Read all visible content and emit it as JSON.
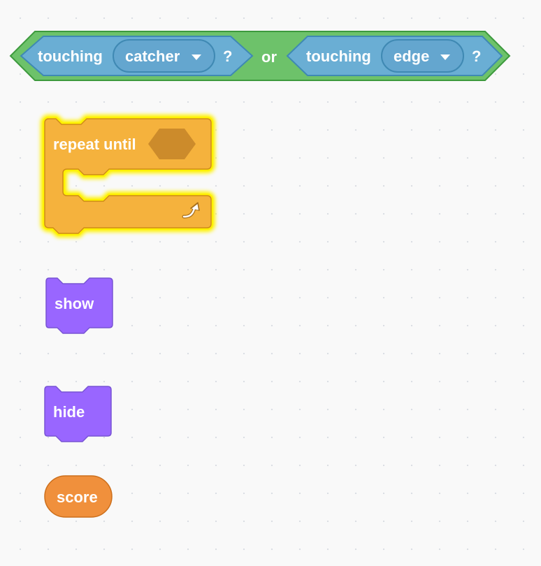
{
  "blocks": {
    "or_condition": {
      "left": {
        "label": "touching",
        "menu_value": "catcher",
        "suffix": "?"
      },
      "operator": "or",
      "right": {
        "label": "touching",
        "menu_value": "edge",
        "suffix": "?"
      }
    },
    "repeat_until": {
      "label": "repeat until"
    },
    "show": {
      "label": "show"
    },
    "hide": {
      "label": "hide"
    },
    "score": {
      "label": "score"
    }
  },
  "colors": {
    "operators": "#59c059",
    "sensing": "#5cb1d6",
    "control": "#ffab19",
    "looks": "#9966ff",
    "variables": "#ff8c1a",
    "glow": "#fff200"
  },
  "icons": {
    "repeat_arrow": "rotate-arrow-icon",
    "dropdown": "caret-down-icon"
  }
}
